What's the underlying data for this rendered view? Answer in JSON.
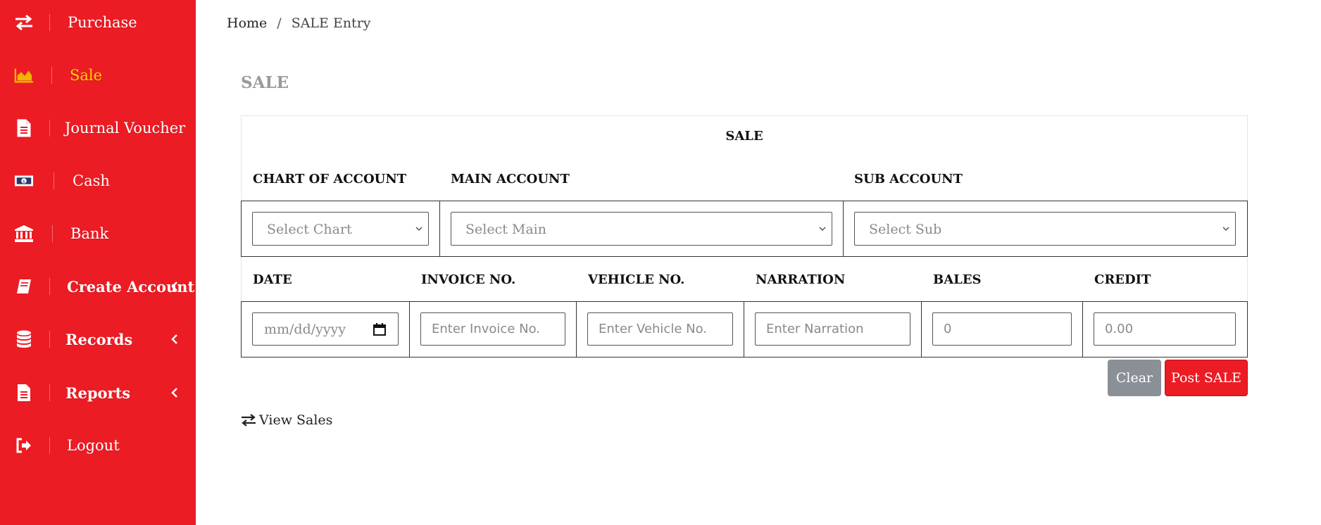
{
  "sidebar": {
    "items": [
      {
        "label": "Purchase",
        "icon": "exchange-arrows-icon"
      },
      {
        "label": "Sale",
        "icon": "area-chart-icon",
        "active": true
      },
      {
        "label": "Journal Voucher",
        "icon": "document-icon"
      },
      {
        "label": "Cash",
        "icon": "money-bill-icon"
      },
      {
        "label": "Bank",
        "icon": "bank-building-icon"
      },
      {
        "label": "Create Account",
        "icon": "book-icon",
        "expandable": true
      },
      {
        "label": "Records",
        "icon": "database-icon",
        "expandable": true
      },
      {
        "label": "Reports",
        "icon": "report-file-icon",
        "expandable": true
      },
      {
        "label": "Logout",
        "icon": "sign-out-icon"
      }
    ]
  },
  "breadcrumb": {
    "home": "Home",
    "separator": "/",
    "current": "SALE Entry"
  },
  "page": {
    "title": "SALE"
  },
  "form": {
    "title": "SALE",
    "row1_headers": {
      "chart": "CHART OF ACCOUNT",
      "main": "MAIN ACCOUNT",
      "sub": "SUB ACCOUNT"
    },
    "selects": {
      "chart": "Select Chart",
      "main": "Select Main",
      "sub": "Select Sub"
    },
    "row2_headers": {
      "date": "DATE",
      "invoice": "INVOICE NO.",
      "vehicle": "VEHICLE NO.",
      "narration": "NARRATION",
      "bales": "BALES",
      "credit": "CREDIT"
    },
    "inputs": {
      "date_placeholder": "mm/dd/yyyy",
      "invoice_placeholder": "Enter Invoice No.",
      "vehicle_placeholder": "Enter Vehicle No.",
      "narration_placeholder": "Enter Narration",
      "bales_placeholder": "0",
      "credit_placeholder": "0.00"
    },
    "buttons": {
      "clear": "Clear",
      "post": "Post SALE"
    }
  },
  "links": {
    "view_sales": "View Sales"
  },
  "colors": {
    "sidebar_bg": "#ec1c24",
    "active_item": "#ffd400",
    "clear_button": "#8a9096",
    "post_button": "#ec1c24",
    "page_title": "#9a9a9a"
  }
}
